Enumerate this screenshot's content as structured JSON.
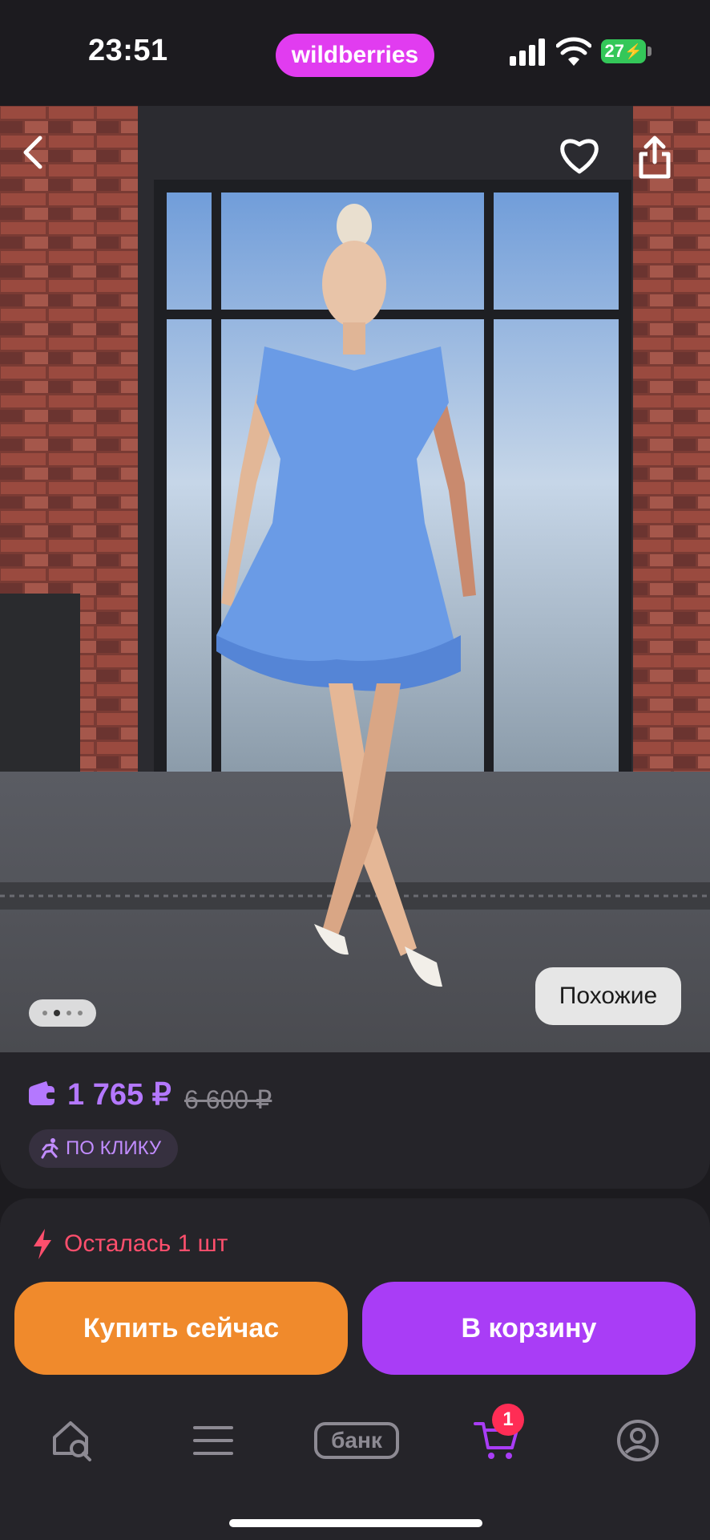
{
  "status_bar": {
    "time": "23:51",
    "battery": "27"
  },
  "header": {
    "brand": "wildberries"
  },
  "gallery": {
    "similar_label": "Похожие",
    "page_count": 4,
    "active_page": 1
  },
  "price": {
    "current": "1 765 ₽",
    "old": "6 600 ₽",
    "click_badge": "ПО КЛИКУ"
  },
  "stock": {
    "text": "Осталась 1 шт"
  },
  "actions": {
    "buy_now": "Купить сейчас",
    "add_to_cart": "В корзину"
  },
  "bottom_nav": {
    "bank_label": "банк",
    "cart_count": "1"
  },
  "colors": {
    "accent_purple": "#a93df6",
    "buy_orange": "#f08a2c",
    "stock_red": "#ff4f6d",
    "brand_pink": "#e13cf0"
  },
  "icons": [
    "back-icon",
    "heart-icon",
    "share-icon",
    "wallet-icon",
    "running-icon",
    "lightning-icon",
    "home-search-icon",
    "menu-icon",
    "cart-icon",
    "profile-icon"
  ]
}
